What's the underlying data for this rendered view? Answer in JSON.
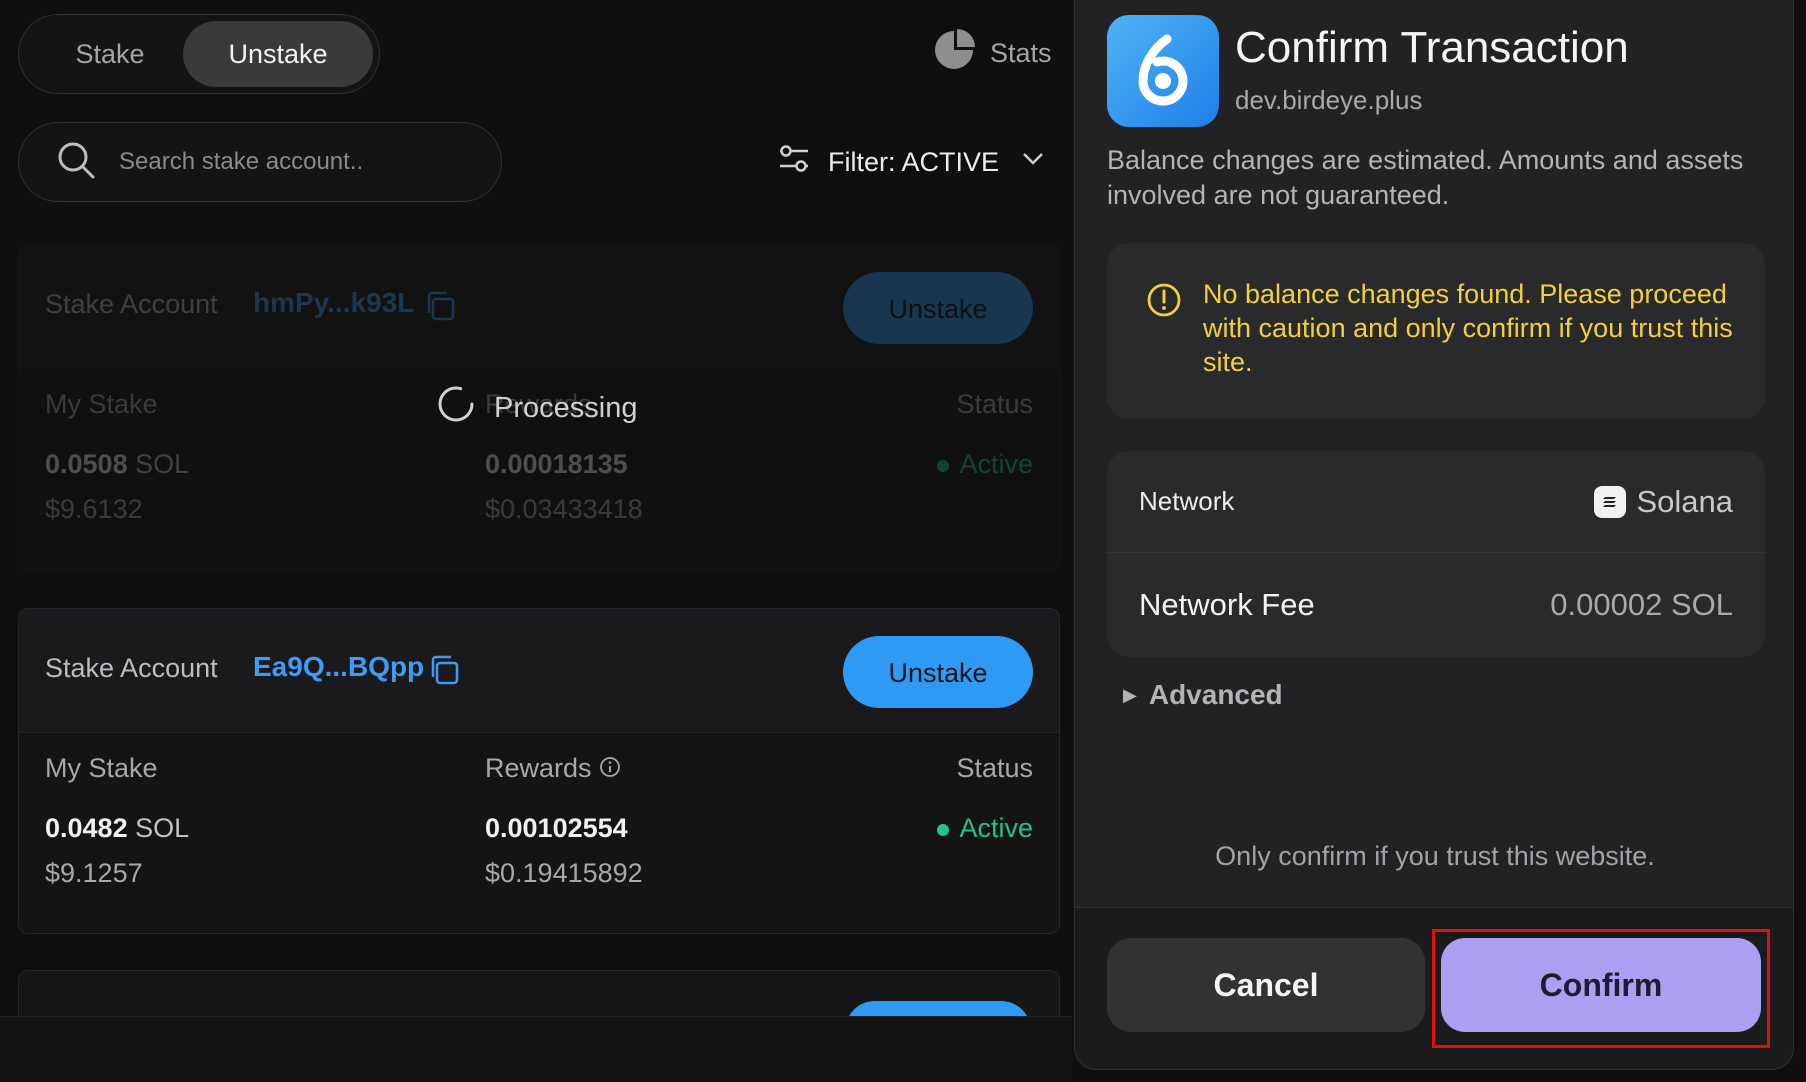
{
  "tabs": {
    "stake": "Stake",
    "unstake": "Unstake",
    "active": "Unstake"
  },
  "stats_label": "Stats",
  "search": {
    "placeholder": "Search stake account.."
  },
  "filter": {
    "label": "Filter: ACTIVE"
  },
  "processing_label": "Processing",
  "cards": [
    {
      "account_label": "Stake Account",
      "address": "hmPy...k93L",
      "button": "Unstake",
      "my_stake_label": "My Stake",
      "rewards_label": "Rewards",
      "status_label": "Status",
      "my_stake_value": "0.0508",
      "unit": "SOL",
      "my_stake_usd": "$9.6132",
      "rewards_value": "0.00018135",
      "rewards_usd": "$0.03433418",
      "status_value": "Active"
    },
    {
      "account_label": "Stake Account",
      "address": "Ea9Q...BQpp",
      "button": "Unstake",
      "my_stake_label": "My Stake",
      "rewards_label": "Rewards",
      "status_label": "Status",
      "my_stake_value": "0.0482",
      "unit": "SOL",
      "my_stake_usd": "$9.1257",
      "rewards_value": "0.00102554",
      "rewards_usd": "$0.19415892",
      "status_value": "Active"
    }
  ],
  "modal": {
    "title": "Confirm Transaction",
    "site": "dev.birdeye.plus",
    "description": "Balance changes are estimated. Amounts and assets involved are not guaranteed.",
    "warning": "No balance changes found. Please proceed with caution and only confirm if you trust this site.",
    "network_label": "Network",
    "network_value": "Solana",
    "fee_label": "Network Fee",
    "fee_value": "0.00002 SOL",
    "advanced": "Advanced",
    "trust_note": "Only confirm if you trust this website.",
    "cancel": "Cancel",
    "confirm": "Confirm"
  },
  "colors": {
    "accent_blue": "#2f9af3",
    "active_green": "#22c389",
    "warning_yellow": "#f0d03c",
    "confirm_purple": "#ab9ff2",
    "highlight_red": "#e01010"
  },
  "icons": [
    "pie-chart-icon",
    "search-icon",
    "filter-sliders-icon",
    "chevron-down-icon",
    "copy-icon",
    "info-icon",
    "spinner-icon",
    "app-logo-icon",
    "warning-circle-icon",
    "solana-icon",
    "triangle-right-icon"
  ]
}
